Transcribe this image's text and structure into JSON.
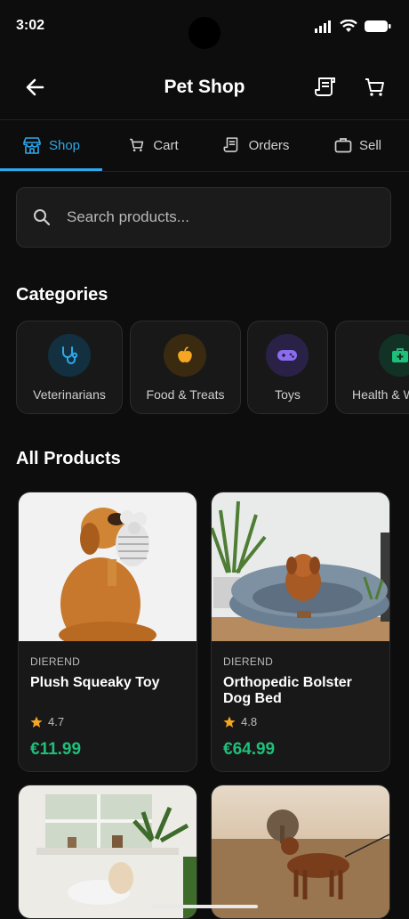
{
  "status": {
    "time": "3:02"
  },
  "header": {
    "title": "Pet Shop"
  },
  "tabs": [
    {
      "label": "Shop",
      "active": true
    },
    {
      "label": "Cart"
    },
    {
      "label": "Orders"
    },
    {
      "label": "Sell"
    }
  ],
  "search": {
    "placeholder": "Search products..."
  },
  "categories": {
    "title": "Categories",
    "items": [
      {
        "label": "Veterinarians",
        "icon": "stethoscope-icon",
        "color": "#2ea8ea"
      },
      {
        "label": "Food & Treats",
        "icon": "apple-icon",
        "color": "#f5a623"
      },
      {
        "label": "Toys",
        "icon": "gamepad-icon",
        "color": "#8b6cf0"
      },
      {
        "label": "Health & W",
        "icon": "medkit-icon",
        "color": "#1fbf7a"
      }
    ]
  },
  "products": {
    "title": "All Products",
    "items": [
      {
        "brand": "DIEREND",
        "name": "Plush Squeaky Toy",
        "rating": "4.7",
        "price": "€11.99"
      },
      {
        "brand": "DIEREND",
        "name": "Orthopedic Bolster Dog Bed",
        "rating": "4.8",
        "price": "€64.99"
      }
    ]
  },
  "colors": {
    "accent": "#2ea8ea",
    "price": "#1fbf7a",
    "star": "#f5a623"
  }
}
